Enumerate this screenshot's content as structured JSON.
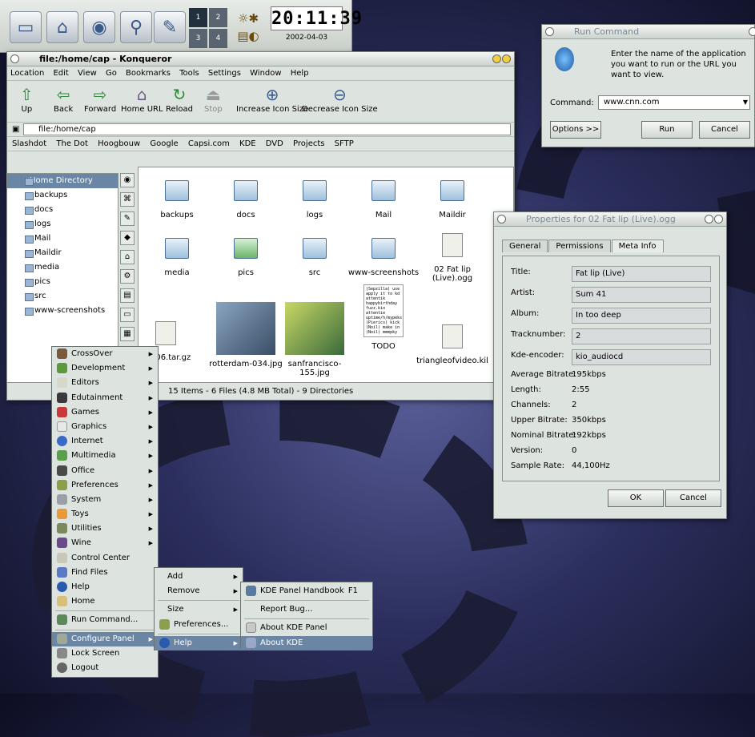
{
  "panel": {
    "pager": [
      "1",
      "2",
      "3",
      "4"
    ],
    "clock_time": "20:11:39",
    "clock_date": "2002-04-03",
    "launchers": [
      "desktop-icon",
      "home-icon",
      "globe-icon",
      "search-icon",
      "editor-icon"
    ]
  },
  "konqueror": {
    "title": "file:/home/cap - Konqueror",
    "menu": [
      "Location",
      "Edit",
      "View",
      "Go",
      "Bookmarks",
      "Tools",
      "Settings",
      "Window",
      "Help"
    ],
    "toolbar": [
      "Up",
      "Back",
      "Forward",
      "Home URL",
      "Reload",
      "Stop",
      "Increase Icon Size",
      "Decrease Icon Size"
    ],
    "url": "file:/home/cap",
    "bookmarks": [
      "Slashdot",
      "The Dot",
      "Hoogbouw",
      "Google",
      "Capsi.com",
      "KDE",
      "DVD",
      "Projects",
      "SFTP"
    ],
    "tree": [
      "Home Directory",
      "backups",
      "docs",
      "logs",
      "Mail",
      "Maildir",
      "media",
      "pics",
      "src",
      "www-screenshots"
    ],
    "files": [
      "backups",
      "docs",
      "logs",
      "Mail",
      "Maildir",
      "media",
      "pics",
      "src",
      "www-screenshots",
      "02 Fat lip (Live).ogg",
      "c-1.06.tar.gz",
      "rotterdam-034.jpg",
      "sanfrancisco-155.jpg",
      "TODO",
      "triangleofvideo.kil"
    ],
    "todo_text": "(Sepzilla) use apply it to kd attentik happybirthday fuzz.kio attentie uptime/h/mypeks (Pierics) kick (Noil) make in (Noil) mmmpky",
    "status": "15 Items - 6 Files (4.8 MB Total) - 9 Directories"
  },
  "run": {
    "title": "Run Command",
    "prompt": "Enter the name of the application you want to run or the URL you want to view.",
    "command_label": "Command:",
    "command_value": "www.cnn.com",
    "options": "Options >>",
    "run": "Run",
    "cancel": "Cancel"
  },
  "props": {
    "title": "Properties for 02 Fat lip (Live).ogg",
    "tabs": [
      "General",
      "Permissions",
      "Meta Info"
    ],
    "fields": [
      {
        "label": "Title:",
        "value": "Fat lip (Live)"
      },
      {
        "label": "Artist:",
        "value": "Sum 41"
      },
      {
        "label": "Album:",
        "value": "In too deep"
      },
      {
        "label": "Tracknumber:",
        "value": "2"
      },
      {
        "label": "Kde-encoder:",
        "value": "kio_audiocd"
      }
    ],
    "info": [
      {
        "label": "Average Bitrate:",
        "value": "195kbps"
      },
      {
        "label": "Length:",
        "value": "2:55"
      },
      {
        "label": "Channels:",
        "value": "2"
      },
      {
        "label": "Upper Bitrate:",
        "value": "350kbps"
      },
      {
        "label": "Nominal Bitrate:",
        "value": "192kbps"
      },
      {
        "label": "Version:",
        "value": "0"
      },
      {
        "label": "Sample Rate:",
        "value": "44,100Hz"
      }
    ],
    "ok": "OK",
    "cancel": "Cancel"
  },
  "kmenu": {
    "items": [
      "CrossOver",
      "Development",
      "Editors",
      "Edutainment",
      "Games",
      "Graphics",
      "Internet",
      "Multimedia",
      "Office",
      "Preferences",
      "System",
      "Toys",
      "Utilities",
      "Wine",
      "Control Center",
      "Find Files",
      "Help",
      "Home",
      "Run Command...",
      "Configure Panel",
      "Lock Screen",
      "Logout"
    ],
    "panel_menu": [
      "Add",
      "Remove",
      "Size",
      "Preferences...",
      "Help"
    ],
    "help_menu": [
      "KDE Panel Handbook",
      "Report Bug...",
      "About KDE Panel",
      "About KDE"
    ],
    "handbook_shortcut": "F1"
  }
}
